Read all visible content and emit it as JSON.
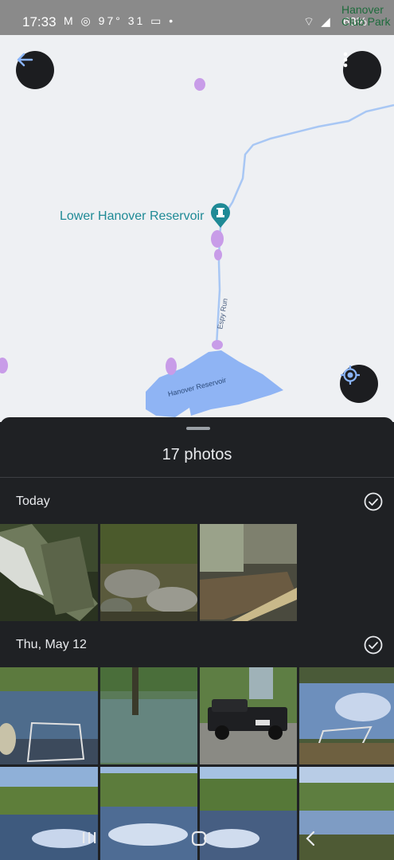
{
  "status_bar": {
    "time": "17:33",
    "icons": "M ◎ 97° 31 ▭ •",
    "wifi": "⌔ ◢",
    "battery": "63%"
  },
  "map": {
    "corner_label": "Hanover Club Park",
    "poi_label": "Lower Hanover Reservoir",
    "stream_label": "Espy Run",
    "lake_label": "Hanover Reservoir",
    "colors": {
      "water": "#8fb4f4",
      "stream": "#a8c7f4",
      "poi": "#1f8a96",
      "highlight": "#c89ce8"
    }
  },
  "buttons": {
    "back_icon": "arrow-left-icon",
    "more_icon": "more-vert-icon",
    "locate_icon": "my-location-icon"
  },
  "sheet": {
    "count": "17 photos",
    "sections": [
      {
        "title": "Today",
        "photos": [
          "log-sign",
          "rocky-stream",
          "concrete-structure"
        ]
      },
      {
        "title": "Thu, May 12",
        "photos": [
          "pond-square",
          "reflection-pond",
          "black-pickup-truck",
          "sky-reflection",
          "lake-mountains-1",
          "lake-mountains-2",
          "lake-mountains-3",
          "lake-trees"
        ]
      }
    ]
  }
}
